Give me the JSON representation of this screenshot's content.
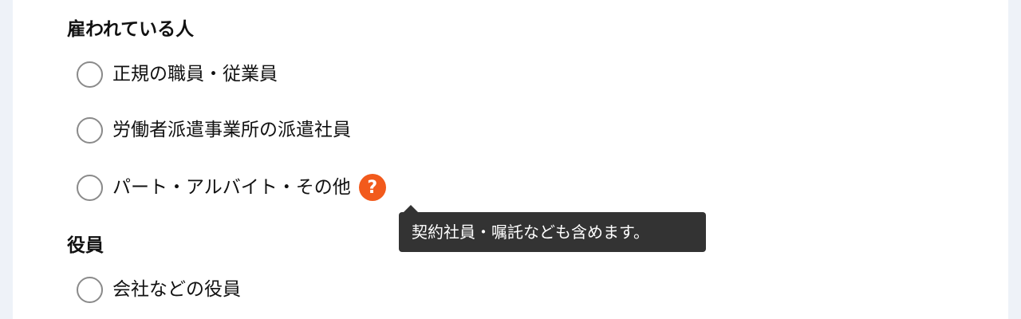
{
  "employed": {
    "heading": "雇われている人",
    "options": [
      {
        "label": "正規の職員・従業員"
      },
      {
        "label": "労働者派遣事業所の派遣社員"
      },
      {
        "label": "パート・アルバイト・その他"
      }
    ],
    "help_icon": {
      "icon": "question-icon",
      "glyph": "?",
      "color": "#f25a1c"
    },
    "tooltip": "契約社員・嘱託なども含めます。"
  },
  "executive": {
    "heading": "役員",
    "options": [
      {
        "label": "会社などの役員"
      }
    ]
  }
}
